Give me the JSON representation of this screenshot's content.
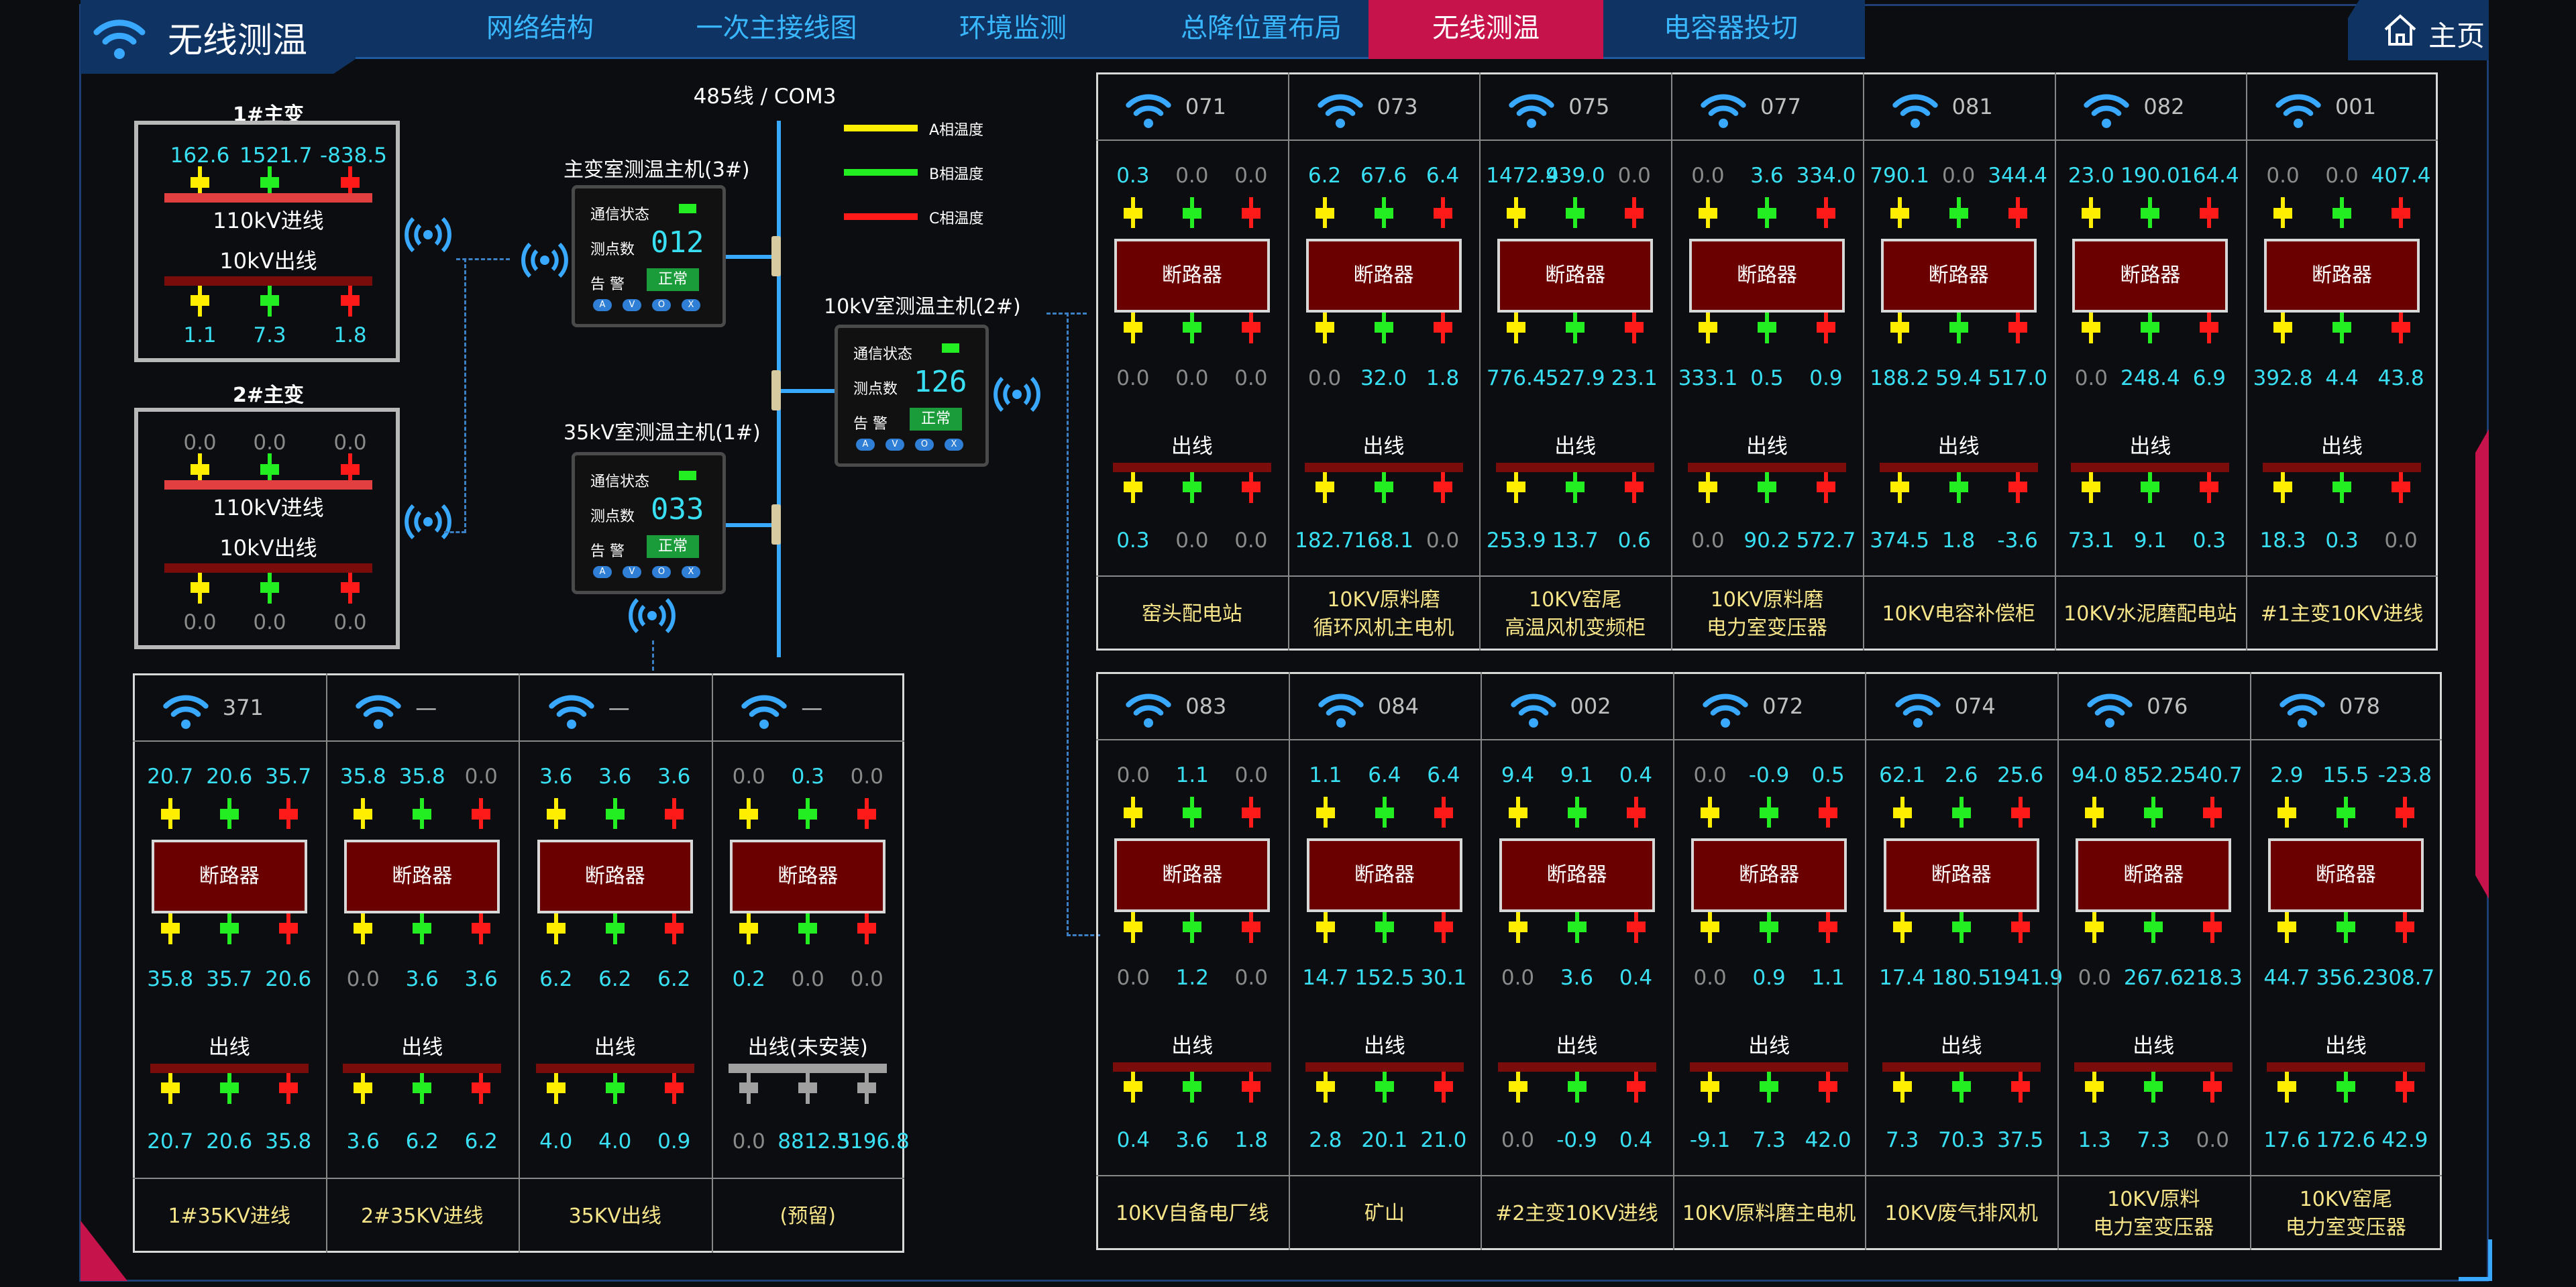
{
  "app": {
    "title": "无线测温",
    "home_label": "主页"
  },
  "nav": {
    "tabs": [
      {
        "label": "网络结构",
        "active": false
      },
      {
        "label": "一次主接线图",
        "active": false
      },
      {
        "label": "环境监测",
        "active": false
      },
      {
        "label": "总降位置布局",
        "active": false
      },
      {
        "label": "无线测温",
        "active": true
      },
      {
        "label": "电容器投切",
        "active": false
      }
    ]
  },
  "colors": {
    "a_phase": "#ffee00",
    "b_phase": "#22ee22",
    "c_phase": "#ff1a1a",
    "accent": "#39a8ff",
    "value": "#39e0f4",
    "breaker": "#6b0000",
    "active_tab": "#c6134b"
  },
  "network": {
    "bus_label": "485线 / COM3",
    "legend": [
      "A相温度",
      "B相温度",
      "C相温度"
    ],
    "hosts": [
      {
        "title": "主变室测温主机(3#)",
        "status_label": "通信状态",
        "points_label": "测点数",
        "points": "012",
        "alarm_label": "告 警",
        "alarm": "正常",
        "buttons": [
          "A",
          "V",
          "O",
          "X"
        ]
      },
      {
        "title": "35kV室测温主机(1#)",
        "status_label": "通信状态",
        "points_label": "测点数",
        "points": "033",
        "alarm_label": "告 警",
        "alarm": "正常",
        "buttons": [
          "A",
          "V",
          "O",
          "X"
        ]
      },
      {
        "title": "10kV室测温主机(2#)",
        "status_label": "通信状态",
        "points_label": "测点数",
        "points": "126",
        "alarm_label": "告 警",
        "alarm": "正常",
        "buttons": [
          "A",
          "V",
          "O",
          "X"
        ]
      }
    ]
  },
  "transformers": [
    {
      "title": "1#主变",
      "in_label": "110kV进线",
      "out_label": "10kV出线",
      "in": [
        "162.6",
        "1521.7",
        "-838.5"
      ],
      "out": [
        "1.1",
        "7.3",
        "1.8"
      ]
    },
    {
      "title": "2#主变",
      "in_label": "110kV进线",
      "out_label": "10kV出线",
      "in": [
        "0.0",
        "0.0",
        "0.0"
      ],
      "out": [
        "0.0",
        "0.0",
        "0.0"
      ]
    }
  ],
  "breaker_label": "断路器",
  "outlet_label": "出线",
  "panels": [
    {
      "key": "top",
      "columns": [
        {
          "id": "071",
          "top": [
            "0.3",
            "0.0",
            "0.0"
          ],
          "mid": [
            "0.0",
            "0.0",
            "0.0"
          ],
          "out": [
            "0.3",
            "0.0",
            "0.0"
          ],
          "name": "窑头配电站"
        },
        {
          "id": "073",
          "top": [
            "6.2",
            "67.6",
            "6.4"
          ],
          "mid": [
            "0.0",
            "32.0",
            "1.8"
          ],
          "out": [
            "182.7",
            "168.1",
            "0.0"
          ],
          "name": "10KV原料磨\n循环风机主电机"
        },
        {
          "id": "075",
          "top": [
            "1472.4",
            "939.0",
            "0.0"
          ],
          "mid": [
            "776.4",
            "527.9",
            "23.1"
          ],
          "out": [
            "253.9",
            "13.7",
            "0.6"
          ],
          "name": "10KV窑尾\n高温风机变频柜"
        },
        {
          "id": "077",
          "top": [
            "0.0",
            "3.6",
            "334.0"
          ],
          "mid": [
            "333.1",
            "0.5",
            "0.9"
          ],
          "out": [
            "0.0",
            "90.2",
            "572.7"
          ],
          "name": "10KV原料磨\n电力室变压器"
        },
        {
          "id": "081",
          "top": [
            "790.1",
            "0.0",
            "344.4"
          ],
          "mid": [
            "188.2",
            "59.4",
            "517.0"
          ],
          "out": [
            "374.5",
            "1.8",
            "-3.6"
          ],
          "name": "10KV电容补偿柜"
        },
        {
          "id": "082",
          "top": [
            "23.0",
            "190.0",
            "164.4"
          ],
          "mid": [
            "0.0",
            "248.4",
            "6.9"
          ],
          "out": [
            "73.1",
            "9.1",
            "0.3"
          ],
          "name": "10KV水泥磨配电站"
        },
        {
          "id": "001",
          "top": [
            "0.0",
            "0.0",
            "407.4"
          ],
          "mid": [
            "392.8",
            "4.4",
            "43.8"
          ],
          "out": [
            "18.3",
            "0.3",
            "0.0"
          ],
          "name": "#1主变10KV进线"
        }
      ]
    },
    {
      "key": "left",
      "columns": [
        {
          "id": "371",
          "top": [
            "20.7",
            "20.6",
            "35.7"
          ],
          "mid": [
            "35.8",
            "35.7",
            "20.6"
          ],
          "out": [
            "20.7",
            "20.6",
            "35.8"
          ],
          "name": "1#35KV进线"
        },
        {
          "id": "—",
          "top": [
            "35.8",
            "35.8",
            "0.0"
          ],
          "mid": [
            "0.0",
            "3.6",
            "3.6"
          ],
          "out": [
            "3.6",
            "6.2",
            "6.2"
          ],
          "name": "2#35KV进线"
        },
        {
          "id": "—",
          "top": [
            "3.6",
            "3.6",
            "3.6"
          ],
          "mid": [
            "6.2",
            "6.2",
            "6.2"
          ],
          "out": [
            "4.0",
            "4.0",
            "0.9"
          ],
          "name": "35KV出线"
        },
        {
          "id": "—",
          "top": [
            "0.0",
            "0.3",
            "0.0"
          ],
          "mid": [
            "0.2",
            "0.0",
            "0.0"
          ],
          "out": [
            "0.0",
            "8812.5",
            "3196.8"
          ],
          "name": "(预留)",
          "out_label": "出线(未安装)",
          "uninstalled": true
        }
      ]
    },
    {
      "key": "bottom",
      "columns": [
        {
          "id": "083",
          "top": [
            "0.0",
            "1.1",
            "0.0"
          ],
          "mid": [
            "0.0",
            "1.2",
            "0.0"
          ],
          "out": [
            "0.4",
            "3.6",
            "1.8"
          ],
          "name": "10KV自备电厂线"
        },
        {
          "id": "084",
          "top": [
            "1.1",
            "6.4",
            "6.4"
          ],
          "mid": [
            "14.7",
            "152.5",
            "30.1"
          ],
          "out": [
            "2.8",
            "20.1",
            "21.0"
          ],
          "name": "矿山"
        },
        {
          "id": "002",
          "top": [
            "9.4",
            "9.1",
            "0.4"
          ],
          "mid": [
            "0.0",
            "3.6",
            "0.4"
          ],
          "out": [
            "0.0",
            "-0.9",
            "0.4"
          ],
          "name": "#2主变10KV进线"
        },
        {
          "id": "072",
          "top": [
            "0.0",
            "-0.9",
            "0.5"
          ],
          "mid": [
            "0.0",
            "0.9",
            "1.1"
          ],
          "out": [
            "-9.1",
            "7.3",
            "42.0"
          ],
          "name": "10KV原料磨主电机"
        },
        {
          "id": "074",
          "top": [
            "62.1",
            "2.6",
            "25.6"
          ],
          "mid": [
            "17.4",
            "180.5",
            "1941.9"
          ],
          "out": [
            "7.3",
            "70.3",
            "37.5"
          ],
          "name": "10KV废气排风机"
        },
        {
          "id": "076",
          "top": [
            "94.0",
            "852.2",
            "540.7"
          ],
          "mid": [
            "0.0",
            "267.6",
            "218.3"
          ],
          "out": [
            "1.3",
            "7.3",
            "0.0"
          ],
          "name": "10KV原料\n电力室变压器"
        },
        {
          "id": "078",
          "top": [
            "2.9",
            "15.5",
            "-23.8"
          ],
          "mid": [
            "44.7",
            "356.2",
            "308.7"
          ],
          "out": [
            "17.6",
            "172.6",
            "42.9"
          ],
          "name": "10KV窑尾\n电力室变压器"
        }
      ]
    }
  ]
}
